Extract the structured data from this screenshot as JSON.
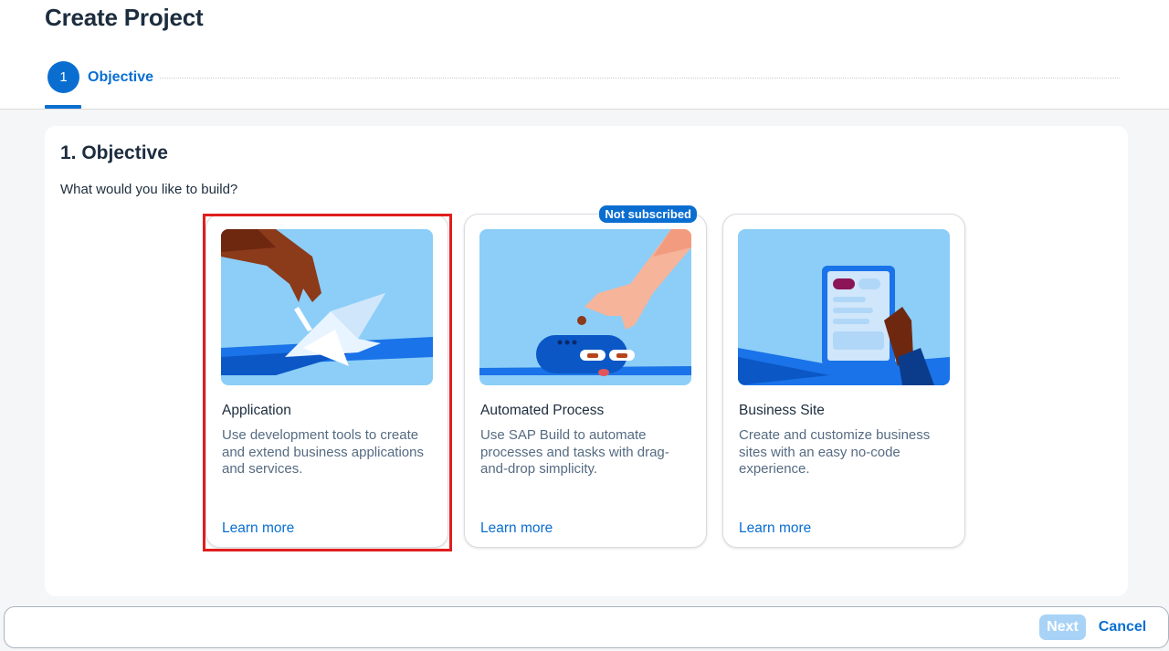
{
  "header": {
    "title": "Create Project",
    "step_number": "1",
    "step_label": "Objective"
  },
  "section": {
    "title": "1. Objective",
    "question": "What would you like to build?"
  },
  "cards": [
    {
      "title": "Application",
      "description": "Use development tools to create and extend business applications and services.",
      "link": "Learn more",
      "illustration": "origami-crane-hand-illustration"
    },
    {
      "title": "Automated Process",
      "description": "Use SAP Build to automate processes and tasks with drag-and-drop simplicity.",
      "link": "Learn more",
      "badge": "Not subscribed",
      "illustration": "robot-hand-illustration"
    },
    {
      "title": "Business Site",
      "description": "Create and customize business sites with an easy no-code experience.",
      "link": "Learn more",
      "illustration": "tablet-hand-illustration"
    }
  ],
  "footer": {
    "next_label": "Next",
    "cancel_label": "Cancel"
  },
  "colors": {
    "accent": "#0a6ed1",
    "illustration_bg": "#8ccef8",
    "selection_outline": "#e01e1e"
  }
}
